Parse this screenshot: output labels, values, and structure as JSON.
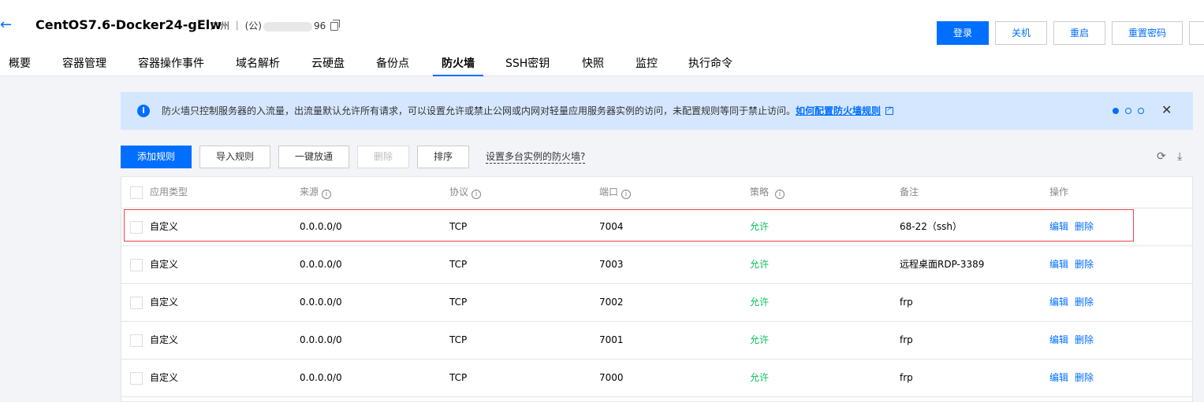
{
  "header": {
    "back_icon": "←",
    "title": "CentOS7.6-Docker24-gElw",
    "region": "广州 ｜ (公)",
    "ip_suffix": "96",
    "actions": [
      "登录",
      "关机",
      "重启",
      "重置密码"
    ]
  },
  "tabs": [
    "概要",
    "容器管理",
    "容器操作事件",
    "域名解析",
    "云硬盘",
    "备份点",
    "防火墙",
    "SSH密钥",
    "快照",
    "监控",
    "执行命令"
  ],
  "active_tab": "防火墙",
  "notice": {
    "text": "防火墙只控制服务器的入流量，出流量默认允许所有请求，可以设置允许或禁止公网或内网对轻量应用服务器实例的访问，未配置规则等同于禁止访问。",
    "link": "如何配置防火墙规则"
  },
  "toolbar": {
    "add": "添加规则",
    "import": "导入规则",
    "allow_all": "一键放通",
    "delete": "删除",
    "sort": "排序",
    "multi_instance": "设置多台实例的防火墙?"
  },
  "table": {
    "columns": [
      "应用类型",
      "来源",
      "协议",
      "端口",
      "策略",
      "备注",
      "操作"
    ],
    "rows": [
      {
        "type": "自定义",
        "source": "0.0.0.0/0",
        "protocol": "TCP",
        "port": "7004",
        "policy": "允许",
        "note": "68-22（ssh）",
        "edit": "编辑",
        "delete": "删除"
      },
      {
        "type": "自定义",
        "source": "0.0.0.0/0",
        "protocol": "TCP",
        "port": "7003",
        "policy": "允许",
        "note": "远程桌面RDP-3389",
        "edit": "编辑",
        "delete": "删除"
      },
      {
        "type": "自定义",
        "source": "0.0.0.0/0",
        "protocol": "TCP",
        "port": "7002",
        "policy": "允许",
        "note": "frp",
        "edit": "编辑",
        "delete": "删除"
      },
      {
        "type": "自定义",
        "source": "0.0.0.0/0",
        "protocol": "TCP",
        "port": "7001",
        "policy": "允许",
        "note": "frp",
        "edit": "编辑",
        "delete": "删除"
      },
      {
        "type": "自定义",
        "source": "0.0.0.0/0",
        "protocol": "TCP",
        "port": "7000",
        "policy": "允许",
        "note": "frp",
        "edit": "编辑",
        "delete": "删除"
      }
    ]
  },
  "colors": {
    "primary": "#006eff",
    "allow": "#0abf5b",
    "notice_bg": "#d5e7ff",
    "highlight": "#e54545"
  }
}
